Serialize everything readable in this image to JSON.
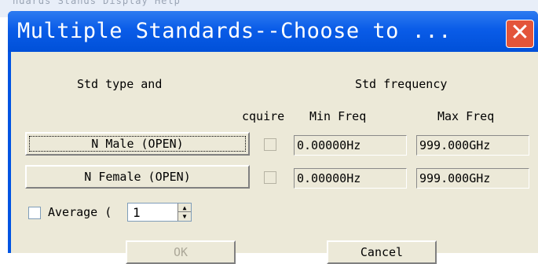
{
  "background": {
    "text": "ndards  Stands  Display  Help"
  },
  "window": {
    "title": "Multiple Standards--Choose to ...",
    "close_icon": "close-icon"
  },
  "headers": {
    "std_type": "Std type and",
    "std_frequency": "Std frequency",
    "acquire": "cquire",
    "min_freq": "Min Freq",
    "max_freq": "Max Freq"
  },
  "rows": [
    {
      "button": "N Male (OPEN)",
      "min": "0.00000Hz",
      "max": "999.000GHz"
    },
    {
      "button": "N Female (OPEN)",
      "min": "0.00000Hz",
      "max": "999.000GHz"
    }
  ],
  "average": {
    "label": "Average (",
    "value": "1"
  },
  "buttons": {
    "ok": "OK",
    "cancel": "Cancel"
  }
}
